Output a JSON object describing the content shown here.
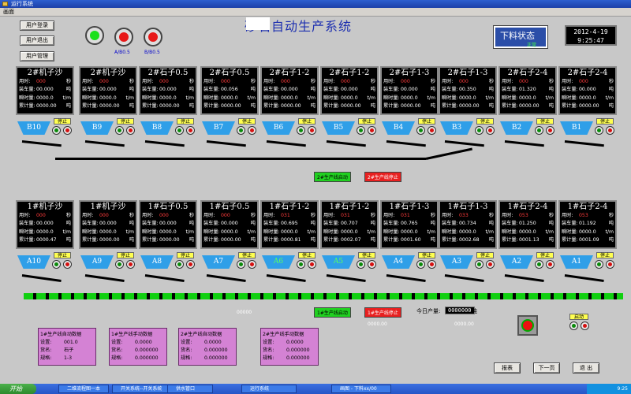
{
  "window": {
    "title": "运行系统",
    "menu": "画面"
  },
  "app_title": "砂石自动生产系统",
  "side_buttons": [
    "用户登录",
    "用户退出",
    "用户管理"
  ],
  "lamps": [
    {
      "label": "A/B0.5"
    },
    {
      "label": "B/B0.5"
    }
  ],
  "status": {
    "title": "下料状态",
    "sub": "正常"
  },
  "clock": {
    "date": "2012-4-19",
    "time": "9:25:47"
  },
  "row_labels": {
    "time": "用时:",
    "load": "装车量:",
    "rate": "瞬时量:",
    "total": "累计量:"
  },
  "units": {
    "time": "秒",
    "load": "吨",
    "rate": "t/m",
    "total": "吨"
  },
  "top_panels": [
    {
      "title": "2#机子沙",
      "time": "000",
      "load": "00.000",
      "rate": "0000.0",
      "total": "0000.00"
    },
    {
      "title": "2#机子沙",
      "time": "000",
      "load": "00.000",
      "rate": "0000.0",
      "total": "0000.00"
    },
    {
      "title": "2#石子0.5",
      "time": "000",
      "load": "00.000",
      "rate": "0000.0",
      "total": "0000.00"
    },
    {
      "title": "2#石子0.5",
      "time": "000",
      "load": "00.056",
      "rate": "0000.0",
      "total": "0000.00"
    },
    {
      "title": "2#石子1-2",
      "time": "000",
      "load": "00.000",
      "rate": "0000.0",
      "total": "0000.00"
    },
    {
      "title": "2#石子1-2",
      "time": "000",
      "load": "00.000",
      "rate": "0000.0",
      "total": "0000.00"
    },
    {
      "title": "2#石子1-3",
      "time": "000",
      "load": "00.000",
      "rate": "0000.0",
      "total": "0000.00"
    },
    {
      "title": "2#石子1-3",
      "time": "000",
      "load": "00.350",
      "rate": "0000.0",
      "total": "0000.00"
    },
    {
      "title": "2#石子2-4",
      "time": "000",
      "load": "01.320",
      "rate": "0000.0",
      "total": "0000.00"
    },
    {
      "title": "2#石子2-4",
      "time": "000",
      "load": "00.000",
      "rate": "0000.0",
      "total": "0000.00"
    }
  ],
  "top_hoppers": [
    "B10",
    "B9",
    "B8",
    "B7",
    "B6",
    "B5",
    "B4",
    "B3",
    "B2",
    "B1"
  ],
  "bottom_panels": [
    {
      "title": "1#机子沙",
      "time": "000",
      "load": "00.000",
      "rate": "0000.0",
      "total": "0000.47"
    },
    {
      "title": "1#机子沙",
      "time": "000",
      "load": "00.000",
      "rate": "0000.0",
      "total": "0000.00"
    },
    {
      "title": "1#石子0.5",
      "time": "000",
      "load": "00.000",
      "rate": "0000.0",
      "total": "0000.00"
    },
    {
      "title": "1#石子0.5",
      "time": "000",
      "load": "00.000",
      "rate": "0000.0",
      "total": "0000.00"
    },
    {
      "title": "1#石子1-2",
      "time": "031",
      "load": "00.695",
      "rate": "0000.0",
      "total": "0000.81"
    },
    {
      "title": "1#石子1-2",
      "time": "031",
      "load": "00.707",
      "rate": "0000.0",
      "total": "0002.07"
    },
    {
      "title": "1#石子1-3",
      "time": "031",
      "load": "00.765",
      "rate": "0000.0",
      "total": "0001.60"
    },
    {
      "title": "1#石子1-3",
      "time": "033",
      "load": "00.734",
      "rate": "0000.0",
      "total": "0002.68"
    },
    {
      "title": "1#石子2-4",
      "time": "053",
      "load": "01.250",
      "rate": "0000.0",
      "total": "0001.13"
    },
    {
      "title": "1#石子2-4",
      "time": "053",
      "load": "01.192",
      "rate": "0000.0",
      "total": "0001.09"
    }
  ],
  "bottom_hoppers": [
    "A10",
    "A9",
    "A8",
    "A7",
    "A6",
    "A5",
    "A4",
    "A3",
    "A2",
    "A1"
  ],
  "stop_label": "停止",
  "line2_buttons": {
    "start": "2#生产线启动",
    "stop": "2#生产线停止"
  },
  "line1_buttons": {
    "start": "1#生产线启动",
    "stop": "1#生产线停止"
  },
  "readouts": {
    "r1": "00000",
    "r2": "0000.00",
    "r3": "0000.00"
  },
  "daily": {
    "label": "今日产量:",
    "value": "0000000",
    "unit": "吨"
  },
  "cards": [
    {
      "header": "1#生产线自动数据",
      "rows": [
        [
          "设置:",
          "001.0"
        ],
        [
          "货名:",
          "石子"
        ],
        [
          "规格:",
          "1-3"
        ]
      ]
    },
    {
      "header": "1#生产线手动数据",
      "rows": [
        [
          "设置:",
          "0.0000"
        ],
        [
          "货名:",
          "0.000000"
        ],
        [
          "规格:",
          "0.000000"
        ]
      ]
    },
    {
      "header": "2#生产线自动数据",
      "rows": [
        [
          "设置:",
          "0.0000"
        ],
        [
          "货名:",
          "0.000000"
        ],
        [
          "规格:",
          "0.000000"
        ]
      ]
    },
    {
      "header": "2#生产线手动数据",
      "rows": [
        [
          "设置:",
          "0.0000"
        ],
        [
          "货名:",
          "0.000000"
        ],
        [
          "规格:",
          "0.000000"
        ]
      ]
    }
  ],
  "start_label": "启动",
  "nav": {
    "report": "报表",
    "next": "下一页",
    "exit": "退 出"
  },
  "taskbar": {
    "start": "开始",
    "tasks": [
      "二维流程图一本",
      "开关系统--开关系统",
      "供水管口",
      "运行系统",
      "画图 - 下料xx/00"
    ],
    "clock": "9:25"
  }
}
